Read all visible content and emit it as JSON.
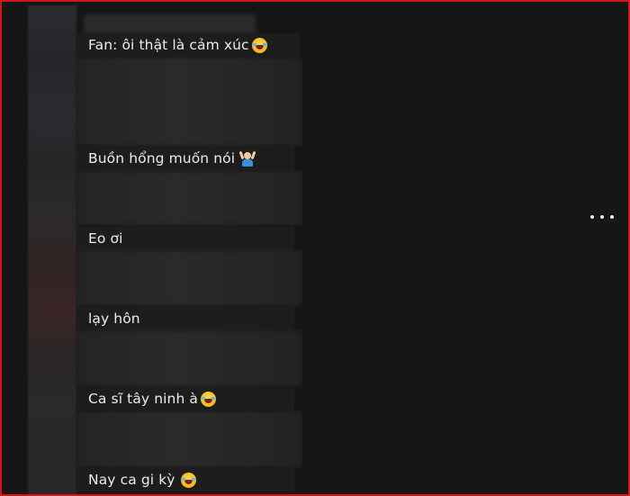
{
  "comments": [
    {
      "text": "Fan: ôi thật là cảm xúc",
      "emoji": "laughing-face-icon"
    },
    {
      "text": "Buồn hổng muốn nói",
      "emoji": "person-raising-hands-icon"
    },
    {
      "text": "Eo ơi",
      "emoji": ""
    },
    {
      "text": "lạy hôn",
      "emoji": ""
    },
    {
      "text": "Ca sĩ tây ninh à",
      "emoji": "laughing-face-icon"
    },
    {
      "text": "Nay ca gi kỳ",
      "emoji": "laughing-face-icon"
    }
  ],
  "more_menu": {
    "icon": "more-horizontal-icon"
  },
  "colors": {
    "frame_border": "#d2141c",
    "background": "#161616",
    "text": "#ececec"
  }
}
